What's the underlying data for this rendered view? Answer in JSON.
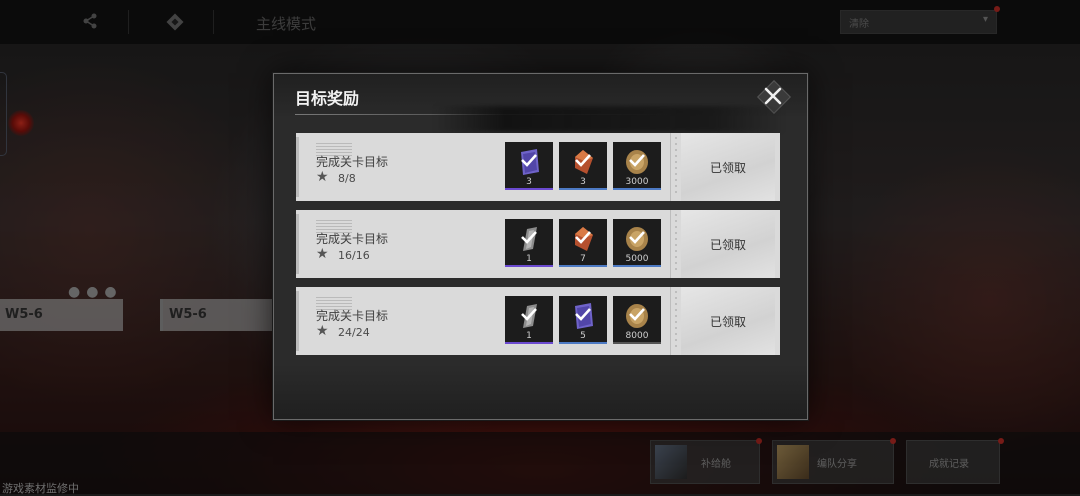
{
  "topbar": {
    "mode_label": "主线模式",
    "search_value": "清除",
    "icons": [
      "share-icon",
      "diamond-nav-icon"
    ]
  },
  "scene": {
    "stages": [
      "W5-6",
      "W5-6"
    ],
    "bottom_cards": [
      "补给舱",
      "编队分享",
      "成就记录"
    ],
    "watermark": "游戏素材监修中"
  },
  "modal": {
    "title": "目标奖励",
    "close_icon": "close-x-icon",
    "rows": [
      {
        "title": "完成关卡目标",
        "progress": "8/8",
        "items": [
          {
            "icon": "purple-card-icon",
            "count": "3",
            "rarity": "purple"
          },
          {
            "icon": "red-crystal-icon",
            "count": "3",
            "rarity": "blue"
          },
          {
            "icon": "coin-icon",
            "count": "3000",
            "rarity": "blue"
          }
        ],
        "status": "已领取"
      },
      {
        "title": "完成关卡目标",
        "progress": "16/16",
        "items": [
          {
            "icon": "gray-chip-icon",
            "count": "1",
            "rarity": "purple"
          },
          {
            "icon": "red-crystal-icon",
            "count": "7",
            "rarity": "blue"
          },
          {
            "icon": "coin-icon",
            "count": "5000",
            "rarity": "blue"
          }
        ],
        "status": "已领取"
      },
      {
        "title": "完成关卡目标",
        "progress": "24/24",
        "items": [
          {
            "icon": "gray-chip-icon",
            "count": "1",
            "rarity": "purple"
          },
          {
            "icon": "purple-card-icon",
            "count": "5",
            "rarity": "blue"
          },
          {
            "icon": "coin-icon",
            "count": "8000",
            "rarity": "gray"
          }
        ],
        "status": "已领取"
      }
    ]
  },
  "colors": {
    "accent_red": "#d9322a",
    "row_bg": "#dadada",
    "modal_bg": "#2b2b2b"
  }
}
